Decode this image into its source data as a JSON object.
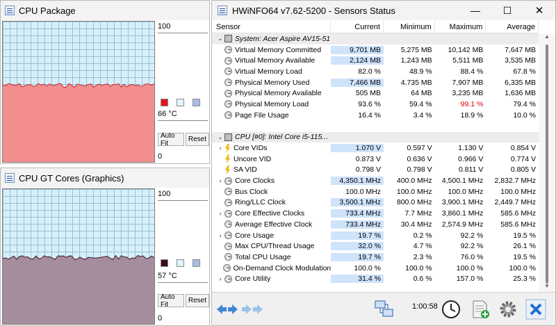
{
  "graph1": {
    "title": "CPU Package",
    "max_label": "100",
    "current_label": "66 °C",
    "min_label": "0",
    "autofit_label": "Auto Fit",
    "reset_label": "Reset",
    "colors": {
      "background": "#d6f0fb",
      "grid": "#9bbfce",
      "fill": "#f28e8e",
      "line": "#c0262b",
      "swatch1": "#e8121b",
      "swatch2": "#dff5fb",
      "swatch3": "#a8bde6"
    },
    "level": 0.66
  },
  "graph2": {
    "title": "CPU GT Cores (Graphics)",
    "max_label": "100",
    "current_label": "57 °C",
    "min_label": "0",
    "autofit_label": "Auto Fit",
    "reset_label": "Reset",
    "colors": {
      "background": "#d6f0fb",
      "grid": "#9bbfce",
      "fill": "#a48e9d",
      "line": "#40102a",
      "swatch1": "#3b0a22",
      "swatch2": "#dff5fb",
      "swatch3": "#a8bde6"
    },
    "level": 0.57
  },
  "sensors": {
    "title": "HWiNFO64 v7.62-5200 - Sensors Status",
    "window_controls": {
      "minimize": "—",
      "maximize": "☐",
      "close": "✕"
    },
    "columns": {
      "sensor": "Sensor",
      "current": "Current",
      "minimum": "Minimum",
      "maximum": "Maximum",
      "average": "Average"
    },
    "rows": [
      {
        "type": "group",
        "name": "System: Acer Aspire AV15-51",
        "icon": "chip-icon",
        "expander": "⌄"
      },
      {
        "type": "item",
        "name": "Virtual Memory Committed",
        "icon": "gauge-icon",
        "current": "9,701 MB",
        "minimum": "5,275 MB",
        "maximum": "10,142 MB",
        "average": "7,647 MB",
        "hl": true
      },
      {
        "type": "item",
        "name": "Virtual Memory Available",
        "icon": "gauge-icon",
        "current": "2,124 MB",
        "minimum": "1,243 MB",
        "maximum": "5,511 MB",
        "average": "3,535 MB",
        "hl": true
      },
      {
        "type": "item",
        "name": "Virtual Memory Load",
        "icon": "gauge-icon",
        "current": "82.0 %",
        "minimum": "48.9 %",
        "maximum": "88.4 %",
        "average": "67.8 %"
      },
      {
        "type": "item",
        "name": "Physical Memory Used",
        "icon": "gauge-icon",
        "current": "7,466 MB",
        "minimum": "4,735 MB",
        "maximum": "7,907 MB",
        "average": "6,335 MB",
        "hl": true
      },
      {
        "type": "item",
        "name": "Physical Memory Available",
        "icon": "gauge-icon",
        "current": "505 MB",
        "minimum": "64 MB",
        "maximum": "3,235 MB",
        "average": "1,636 MB"
      },
      {
        "type": "item",
        "name": "Physical Memory Load",
        "icon": "gauge-icon",
        "current": "93.6 %",
        "minimum": "59.4 %",
        "maximum": "99.1 %",
        "average": "79.4 %",
        "red": true
      },
      {
        "type": "item",
        "name": "Page File Usage",
        "icon": "gauge-icon",
        "current": "16.4 %",
        "minimum": "3.4 %",
        "maximum": "18.9 %",
        "average": "10.0 %"
      },
      {
        "type": "gap"
      },
      {
        "type": "group",
        "name": "CPU [#0]: Intel Core i5-115...",
        "icon": "chip-icon",
        "expander": "⌄"
      },
      {
        "type": "item",
        "name": "Core VIDs",
        "icon": "volt-icon",
        "expander": "›",
        "indent": true,
        "current": "1.070 V",
        "minimum": "0.597 V",
        "maximum": "1.130 V",
        "average": "0.854 V",
        "hl": true
      },
      {
        "type": "item",
        "name": "Uncore VID",
        "icon": "volt-icon",
        "current": "0.873 V",
        "minimum": "0.636 V",
        "maximum": "0.966 V",
        "average": "0.774 V"
      },
      {
        "type": "item",
        "name": "SA VID",
        "icon": "volt-icon",
        "current": "0.798 V",
        "minimum": "0.798 V",
        "maximum": "0.811 V",
        "average": "0.805 V"
      },
      {
        "type": "item",
        "name": "Core Clocks",
        "icon": "gauge-icon",
        "expander": "›",
        "indent": true,
        "current": "4,350.1 MHz",
        "minimum": "400.0 MHz",
        "maximum": "4,500.1 MHz",
        "average": "2,832.7 MHz",
        "hl": true
      },
      {
        "type": "item",
        "name": "Bus Clock",
        "icon": "gauge-icon",
        "current": "100.0 MHz",
        "minimum": "100.0 MHz",
        "maximum": "100.0 MHz",
        "average": "100.0 MHz"
      },
      {
        "type": "item",
        "name": "Ring/LLC Clock",
        "icon": "gauge-icon",
        "current": "3,500.1 MHz",
        "minimum": "800.0 MHz",
        "maximum": "3,900.1 MHz",
        "average": "2,449.7 MHz",
        "hl": true
      },
      {
        "type": "item",
        "name": "Core Effective Clocks",
        "icon": "gauge-icon",
        "expander": "›",
        "indent": true,
        "current": "733.4 MHz",
        "minimum": "7.7 MHz",
        "maximum": "3,860.1 MHz",
        "average": "585.6 MHz",
        "hl": true
      },
      {
        "type": "item",
        "name": "Average Effective Clock",
        "icon": "gauge-icon",
        "current": "733.4 MHz",
        "minimum": "30.4 MHz",
        "maximum": "2,574.9 MHz",
        "average": "585.6 MHz",
        "hl": true
      },
      {
        "type": "item",
        "name": "Core Usage",
        "icon": "gauge-icon",
        "expander": "›",
        "indent": true,
        "current": "19.7 %",
        "minimum": "0.2 %",
        "maximum": "92.2 %",
        "average": "19.5 %",
        "hl": true
      },
      {
        "type": "item",
        "name": "Max CPU/Thread Usage",
        "icon": "gauge-icon",
        "current": "32.0 %",
        "minimum": "4.7 %",
        "maximum": "92.2 %",
        "average": "26.1 %",
        "hl": true
      },
      {
        "type": "item",
        "name": "Total CPU Usage",
        "icon": "gauge-icon",
        "current": "19.7 %",
        "minimum": "2.3 %",
        "maximum": "76.0 %",
        "average": "19.5 %",
        "hl": true
      },
      {
        "type": "item",
        "name": "On-Demand Clock Modulation",
        "icon": "gauge-icon",
        "current": "100.0 %",
        "minimum": "100.0 %",
        "maximum": "100.0 %",
        "average": "100.0 %"
      },
      {
        "type": "item",
        "name": "Core Utility",
        "icon": "gauge-icon",
        "expander": "›",
        "indent": true,
        "current": "31.4 %",
        "minimum": "0.6 %",
        "maximum": "157.0 %",
        "average": "25.3 %",
        "hl": true
      }
    ],
    "footer": {
      "timer": "1:00:58",
      "icons": [
        "arrows-left-right-icon",
        "arrows-right-icon",
        "network-icon",
        "clock-icon",
        "add-report-icon",
        "settings-gear-icon",
        "close-x-icon"
      ]
    }
  }
}
